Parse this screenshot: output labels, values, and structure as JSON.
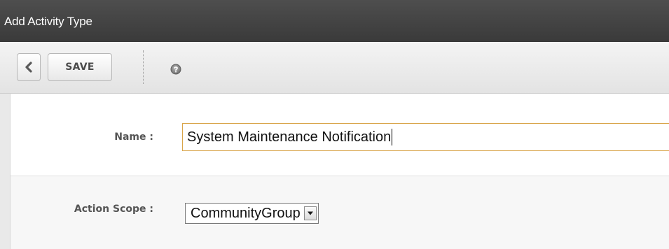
{
  "window": {
    "title": "Add Activity Type"
  },
  "toolbar": {
    "back_icon": "chevron-left-icon",
    "save_label": "SAVE",
    "help_icon": "help-icon"
  },
  "form": {
    "name": {
      "label": "Name :",
      "value": "System Maintenance Notification"
    },
    "action_scope": {
      "label": "Action Scope :",
      "selected": "CommunityGroup"
    }
  },
  "colors": {
    "titlebar": "#3f3f3f",
    "input_focus_border": "#d9a54a"
  }
}
